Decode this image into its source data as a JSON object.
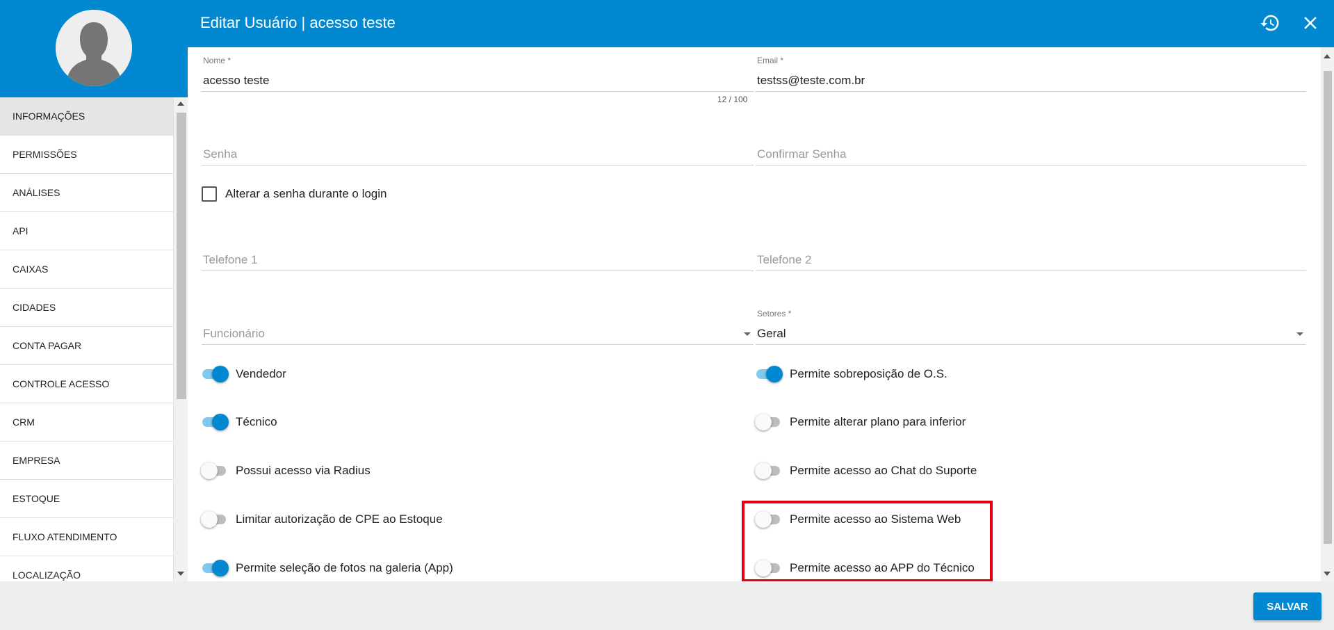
{
  "window": {
    "title": "Editar Usuário | acesso teste"
  },
  "header": {
    "icons": [
      "history-icon",
      "close-icon"
    ]
  },
  "sidebar": {
    "items": [
      {
        "label": "INFORMAÇÕES",
        "active": true
      },
      {
        "label": "PERMISSÕES"
      },
      {
        "label": "ANÁLISES"
      },
      {
        "label": "API"
      },
      {
        "label": "CAIXAS"
      },
      {
        "label": "CIDADES"
      },
      {
        "label": "CONTA PAGAR"
      },
      {
        "label": "CONTROLE ACESSO"
      },
      {
        "label": "CRM"
      },
      {
        "label": "EMPRESA"
      },
      {
        "label": "ESTOQUE"
      },
      {
        "label": "FLUXO ATENDIMENTO"
      },
      {
        "label": "LOCALIZAÇÃO"
      }
    ]
  },
  "form": {
    "nome": {
      "label": "Nome *",
      "value": "acesso teste",
      "counter": "12 / 100"
    },
    "email": {
      "label": "Email *",
      "value": "testss@teste.com.br"
    },
    "senha": {
      "placeholder": "Senha"
    },
    "confirmar_senha": {
      "placeholder": "Confirmar Senha"
    },
    "alterar_senha": {
      "label": "Alterar a senha durante o login",
      "checked": false
    },
    "telefone1": {
      "placeholder": "Telefone 1"
    },
    "telefone2": {
      "placeholder": "Telefone 2"
    },
    "funcionario": {
      "placeholder": "Funcionário"
    },
    "setores": {
      "label": "Setores *",
      "value": "Geral"
    }
  },
  "toggles_left": [
    {
      "label": "Vendedor",
      "on": true
    },
    {
      "label": "Técnico",
      "on": true
    },
    {
      "label": "Possui acesso via Radius",
      "on": false
    },
    {
      "label": "Limitar autorização de CPE ao Estoque",
      "on": false
    },
    {
      "label": "Permite seleção de fotos na galeria (App)",
      "on": true
    }
  ],
  "toggles_right": [
    {
      "label": "Permite sobreposição de O.S.",
      "on": true
    },
    {
      "label": "Permite alterar plano para inferior",
      "on": false
    },
    {
      "label": "Permite acesso ao Chat do Suporte",
      "on": false
    },
    {
      "label": "Permite acesso ao Sistema Web",
      "on": false
    },
    {
      "label": "Permite acesso ao APP do Técnico",
      "on": false
    }
  ],
  "footer": {
    "save_label": "SALVAR"
  },
  "colors": {
    "primary": "#0288d1",
    "highlight": "#e3000f"
  }
}
